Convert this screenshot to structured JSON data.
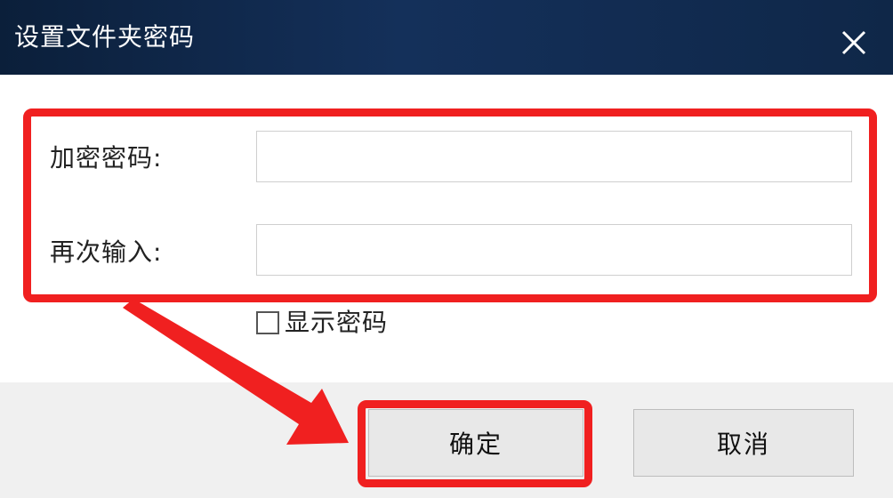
{
  "window": {
    "title": "设置文件夹密码"
  },
  "form": {
    "password_label": "加密密码:",
    "password_value": "",
    "confirm_label": "再次输入:",
    "confirm_value": ""
  },
  "options": {
    "show_password_label": "显示密码",
    "show_password_checked": false
  },
  "buttons": {
    "ok_label": "确定",
    "cancel_label": "取消"
  },
  "icons": {
    "close": "close-icon",
    "checkbox": "checkbox-unchecked-icon",
    "annotation_arrow": "arrow-icon"
  },
  "colors": {
    "titlebar": "#14305a",
    "annotation": "#f02020",
    "footer": "#f0f0f0"
  }
}
